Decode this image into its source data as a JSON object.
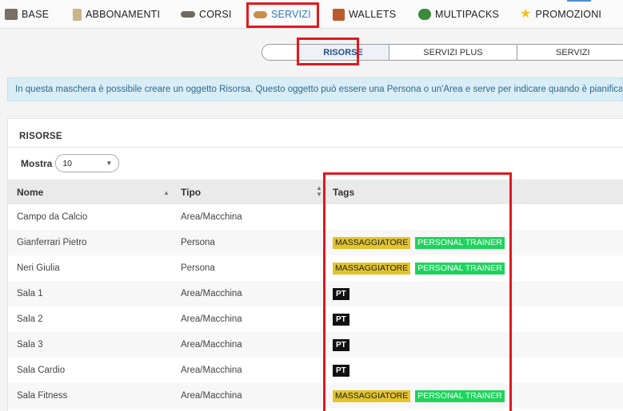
{
  "nav": {
    "tabs": [
      {
        "id": "base",
        "label": "BASE",
        "icon": "box-icon",
        "color": "#7a6f63"
      },
      {
        "id": "abbonamenti",
        "label": "ABBONAMENTI",
        "icon": "card-icon",
        "color": "#c9b48a"
      },
      {
        "id": "corsi",
        "label": "CORSI",
        "icon": "hat-icon",
        "color": "#6f6a5f"
      },
      {
        "id": "servizi",
        "label": "SERVIZI",
        "icon": "handshake-icon",
        "color": "#c98f4a",
        "active": true
      },
      {
        "id": "wallets",
        "label": "WALLETS",
        "icon": "wallet-icon",
        "color": "#b85a2a"
      },
      {
        "id": "multipacks",
        "label": "MULTIPACKS",
        "icon": "package-icon",
        "color": "#3a8a3a"
      },
      {
        "id": "promozioni",
        "label": "PROMOZIONI",
        "icon": "star-icon",
        "color": "#f2c214"
      }
    ]
  },
  "subnav": {
    "tabs": [
      {
        "label": "",
        "active": false
      },
      {
        "label": "RISORSE",
        "active": true
      },
      {
        "label": "SERVIZI PLUS",
        "active": false
      },
      {
        "label": "SERVIZI",
        "active": false
      }
    ]
  },
  "info": {
    "text": "In questa maschera è possibile creare un oggetto Risorsa. Questo oggetto può essere una Persona o un'Area e serve per indicare quando è pianifica"
  },
  "panel": {
    "title": "RISORSE",
    "mostra_label": "Mostra",
    "page_size": "10"
  },
  "table": {
    "columns": [
      "Nome",
      "Tipo",
      "Tags"
    ],
    "rows": [
      {
        "nome": "Campo da Calcio",
        "tipo": "Area/Macchina",
        "tags": []
      },
      {
        "nome": "Gianferrari Pietro",
        "tipo": "Persona",
        "tags": [
          "MASSAGGIATORE",
          "PERSONAL TRAINER"
        ]
      },
      {
        "nome": "Neri Giulia",
        "tipo": "Persona",
        "tags": [
          "MASSAGGIATORE",
          "PERSONAL TRAINER"
        ]
      },
      {
        "nome": "Sala 1",
        "tipo": "Area/Macchina",
        "tags": [
          "PT"
        ]
      },
      {
        "nome": "Sala 2",
        "tipo": "Area/Macchina",
        "tags": [
          "PT"
        ]
      },
      {
        "nome": "Sala 3",
        "tipo": "Area/Macchina",
        "tags": [
          "PT"
        ]
      },
      {
        "nome": "Sala Cardio",
        "tipo": "Area/Macchina",
        "tags": [
          "PT"
        ]
      },
      {
        "nome": "Sala Fitness",
        "tipo": "Area/Macchina",
        "tags": [
          "MASSAGGIATORE",
          "PERSONAL TRAINER"
        ]
      }
    ]
  },
  "colors": {
    "accent": "#2f7bbf",
    "highlight": "#e0191e",
    "tag_massaggiatore": "#e3c42a",
    "tag_personal_trainer": "#1fd35d",
    "tag_pt": "#111111",
    "info_bg": "#d9edf7"
  }
}
